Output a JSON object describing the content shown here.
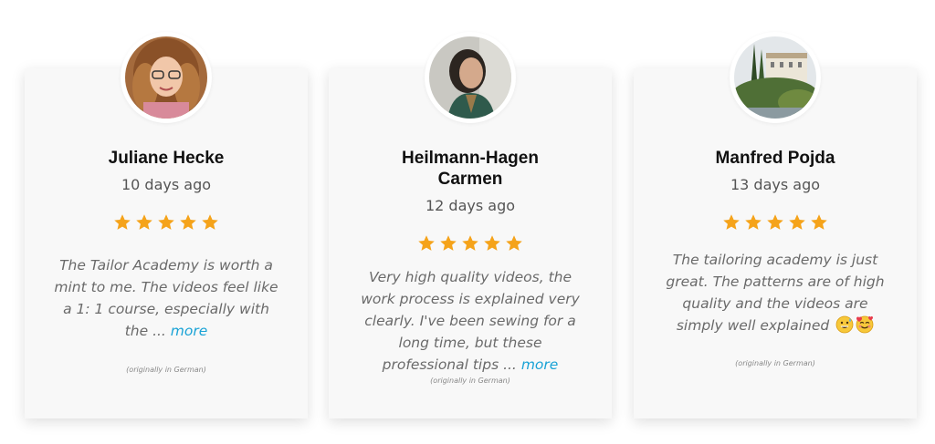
{
  "reviews": [
    {
      "name": "Juliane Hecke",
      "date": "10 days ago",
      "rating": 5,
      "text": "The Tailor Academy is worth a mint to me. The videos feel like a 1: 1 course, especially with the ...",
      "more_label": "more",
      "note": "(originally in German)",
      "avatar": "woman-curly-hair-glasses-photo"
    },
    {
      "name": "Heilmann-Hagen Carmen",
      "date": "12 days ago",
      "rating": 5,
      "text": "Very high quality videos, the work process is explained very clearly. I've been sewing for a long time, but these professional tips ...",
      "more_label": "more",
      "note": "(originally in German)",
      "avatar": "woman-dark-hair-photo"
    },
    {
      "name": "Manfred Pojda",
      "date": "13 days ago",
      "rating": 5,
      "text": "The tailoring academy is just great. The patterns are of high quality and the videos are simply well explained",
      "emojis": [
        "grinning-sweat-emoji",
        "smiling-face-with-hearts-emoji"
      ],
      "note": "(originally in German)",
      "avatar": "villa-landscape-photo"
    }
  ],
  "colors": {
    "star": "#f5a31a",
    "link": "#1aa3d6",
    "card_bg": "#f8f8f8"
  }
}
